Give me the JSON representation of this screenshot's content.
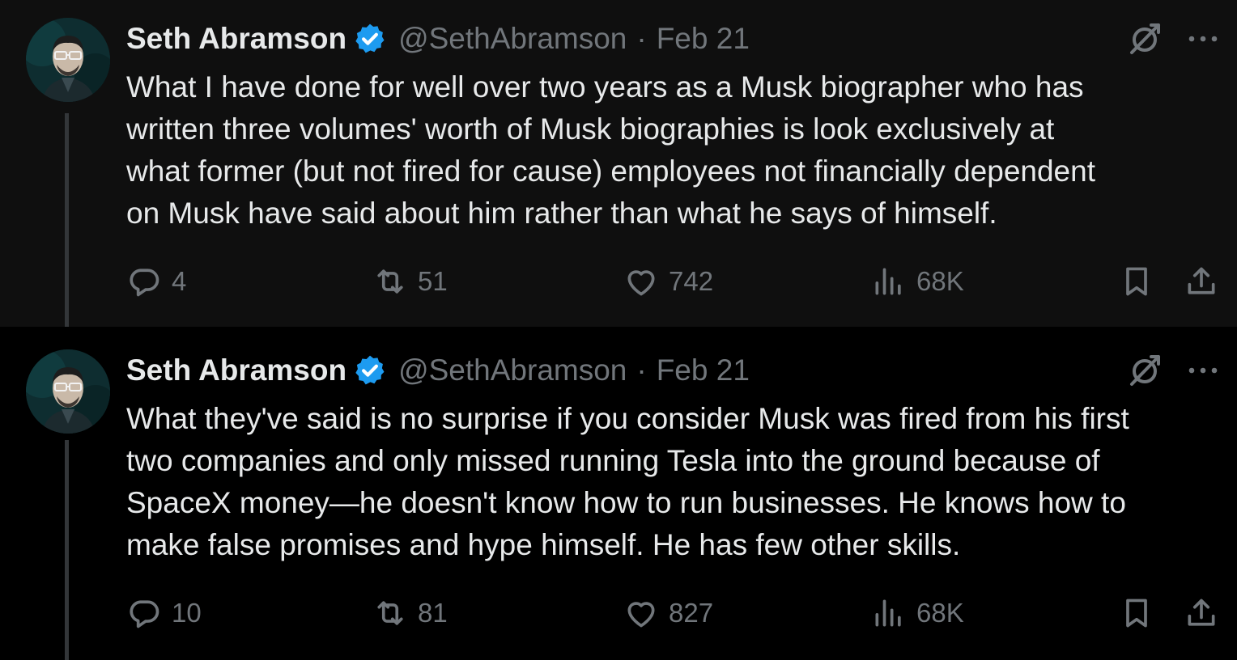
{
  "colors": {
    "background": "#000000",
    "first_tweet_background": "#0f0f0f",
    "text_primary": "#e7e9ea",
    "text_secondary": "#71767b",
    "verified_blue": "#1d9bf0",
    "thread_line": "#333639"
  },
  "icons": {
    "verified": "verified-badge-icon",
    "grok": "grok-icon",
    "more": "more-horizontal-icon",
    "reply": "reply-bubble-icon",
    "repost": "repost-arrows-icon",
    "like": "heart-icon",
    "views": "bar-chart-icon",
    "bookmark": "bookmark-icon",
    "share": "share-upload-icon"
  },
  "tweets": [
    {
      "author_name": "Seth Abramson",
      "handle": "@SethAbramson",
      "separator": "·",
      "date": "Feb 21",
      "text": "What I have done for well over two years as a Musk biographer who has\nwritten three volumes' worth of Musk biographies is look exclusively at\nwhat former (but not fired for cause) employees not financially dependent\non Musk have said about him rather than what he says of himself.",
      "replies": "4",
      "reposts": "51",
      "likes": "742",
      "views": "68K"
    },
    {
      "author_name": "Seth Abramson",
      "handle": "@SethAbramson",
      "separator": "·",
      "date": "Feb 21",
      "text": "What they've said is no surprise if you consider Musk was fired from his first\ntwo companies and only missed running Tesla into the ground because of\nSpaceX money—he doesn't know how to run businesses. He knows how to\nmake false promises and hype himself. He has few other skills.",
      "replies": "10",
      "reposts": "81",
      "likes": "827",
      "views": "68K"
    }
  ]
}
